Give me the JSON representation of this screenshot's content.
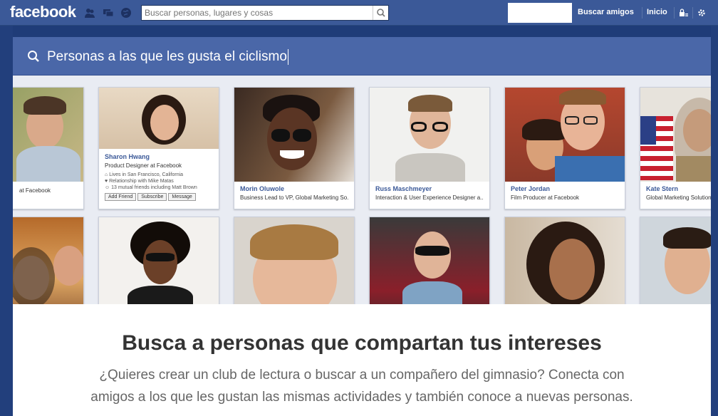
{
  "topbar": {
    "logo": "facebook",
    "search_placeholder": "Buscar personas, lugares y cosas",
    "find_friends": "Buscar amigos",
    "home": "Inicio",
    "jewels": [
      "friend-requests-icon",
      "messages-icon",
      "notifications-icon"
    ]
  },
  "graph_search": {
    "query": "Personas a las que les gusta el ciclismo"
  },
  "cards_row1": [
    {
      "name": "",
      "role": "at Facebook"
    },
    {
      "name": "Sharon Hwang",
      "role": "Product Designer at Facebook",
      "details": [
        "Lives in San Francisco, California",
        "Relationship with Mike Matas",
        "13 mutual friends including Matt Brown"
      ],
      "buttons": [
        "Add Friend",
        "Subscribe",
        "Message"
      ]
    },
    {
      "name": "Morin Oluwole",
      "role": "Business Lead to VP, Global Marketing So..."
    },
    {
      "name": "Russ Maschmeyer",
      "role": "Interaction & User Experience Designer a..."
    },
    {
      "name": "Peter Jordan",
      "role": "Film Producer at Facebook"
    },
    {
      "name": "Kate Stern",
      "role": "Global Marketing Solutions"
    }
  ],
  "panel": {
    "headline": "Busca a personas que compartan tus intereses",
    "line1": "¿Quieres crear un club de lectura o buscar a un compañero del gimnasio? Conecta con",
    "line2": "amigos a los que les gustan las mismas actividades y también conoce a nuevas personas."
  },
  "colors": {
    "brand": "#3b5998",
    "search_bar": "#4a67a8",
    "link": "#3b5998"
  }
}
